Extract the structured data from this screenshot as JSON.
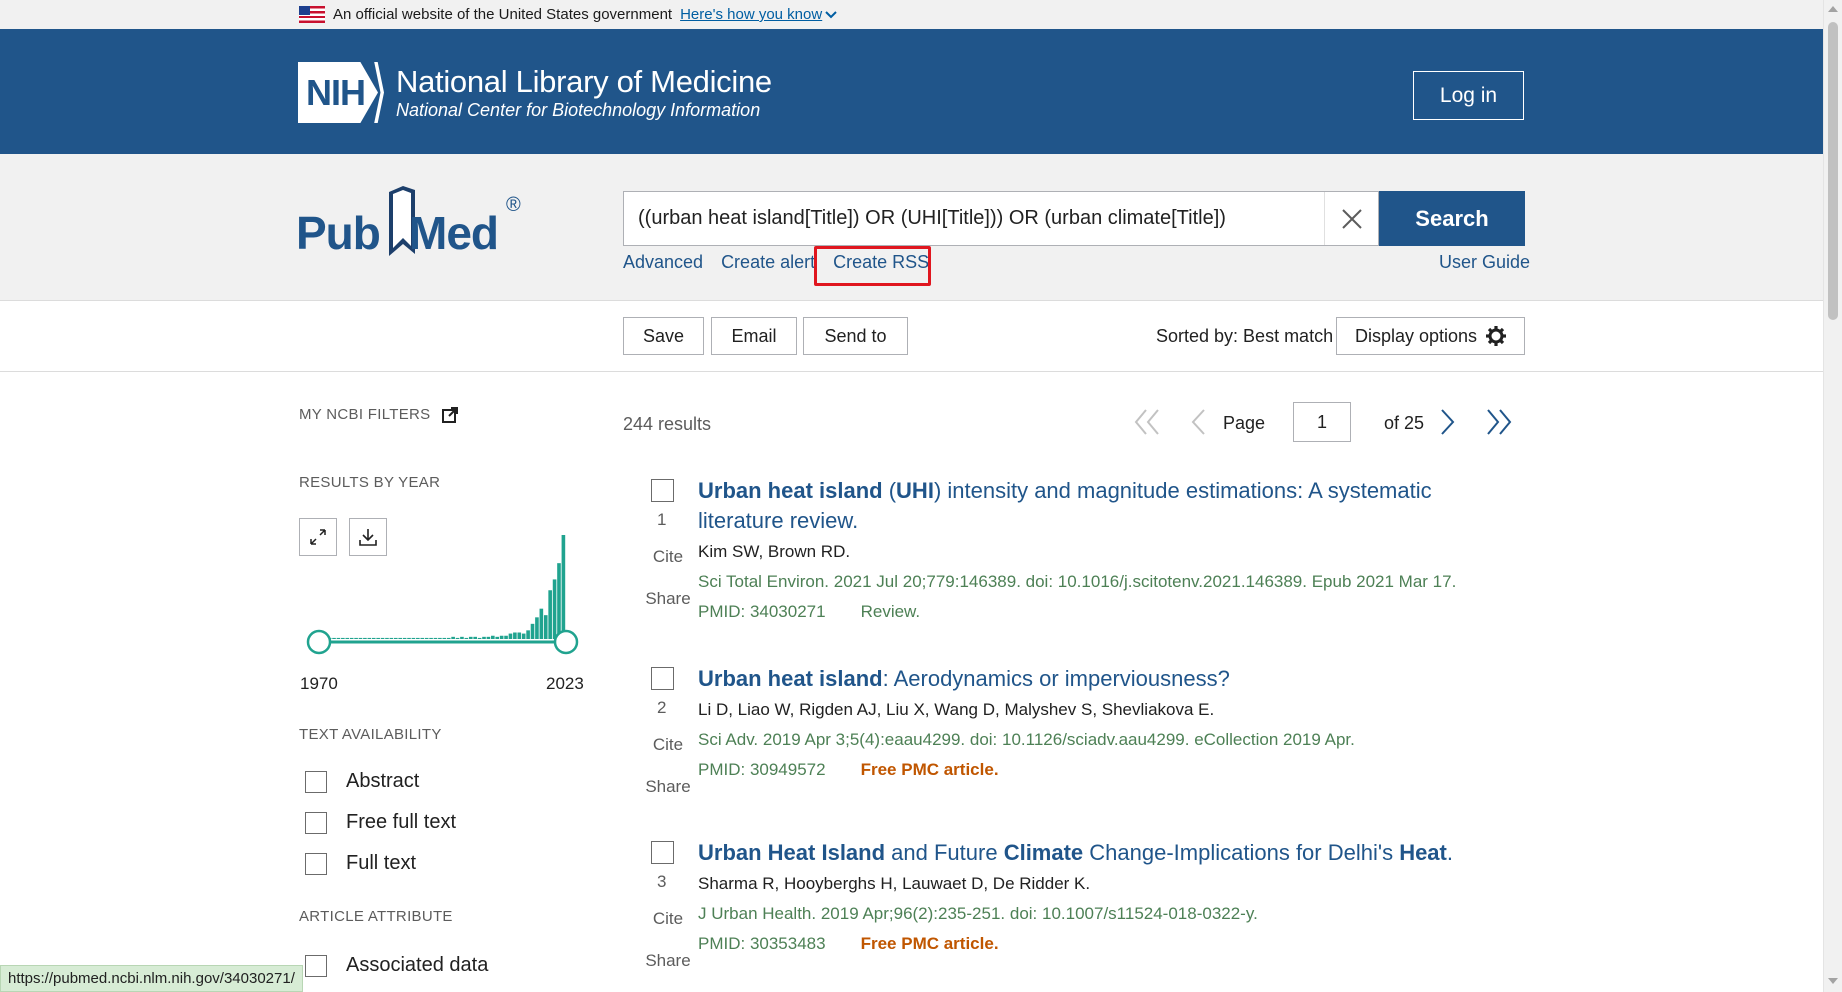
{
  "gov_banner": {
    "text": "An official website of the United States government",
    "link": "Here's how you know"
  },
  "header": {
    "nih_logo": "NIH",
    "title": "National Library of Medicine",
    "subtitle": "National Center for Biotechnology Information",
    "login": "Log in"
  },
  "search": {
    "logo_pub": "Pub",
    "logo_med": "Med",
    "logo_reg": "®",
    "query": "((urban heat island[Title]) OR (UHI[Title])) OR (urban climate[Title])",
    "button": "Search",
    "links": {
      "advanced": "Advanced",
      "create_alert": "Create alert",
      "create_rss": "Create RSS"
    },
    "user_guide": "User Guide"
  },
  "toolbar": {
    "save": "Save",
    "email": "Email",
    "send_to": "Send to",
    "sorted_by": "Sorted by: Best match",
    "display_options": "Display options"
  },
  "sidebar": {
    "my_filters": "MY NCBI FILTERS",
    "results_by_year": "RESULTS BY YEAR",
    "year_start": "1970",
    "year_end": "2023",
    "text_availability": "TEXT AVAILABILITY",
    "filters": [
      "Abstract",
      "Free full text",
      "Full text"
    ],
    "article_attribute": "ARTICLE ATTRIBUTE",
    "attribute_filters": [
      "Associated data"
    ]
  },
  "results_meta": {
    "count": "244 results",
    "page_label": "Page",
    "page_value": "1",
    "page_of": "of 25"
  },
  "results": [
    {
      "number": "1",
      "title_parts": [
        {
          "t": "Urban heat island",
          "b": true
        },
        {
          "t": " (",
          "b": false
        },
        {
          "t": "UHI",
          "b": true
        },
        {
          "t": ") intensity and magnitude estimations: A systematic literature review.",
          "b": false
        }
      ],
      "authors": "Kim SW, Brown RD.",
      "citation": "Sci Total Environ. 2021 Jul 20;779:146389. doi: 10.1016/j.scitotenv.2021.146389. Epub 2021 Mar 17.",
      "pmid": "PMID: 34030271",
      "tag": "Review.",
      "tag_type": "type",
      "cite": "Cite",
      "share": "Share"
    },
    {
      "number": "2",
      "title_parts": [
        {
          "t": "Urban heat island",
          "b": true
        },
        {
          "t": ": Aerodynamics or imperviousness?",
          "b": false
        }
      ],
      "authors": "Li D, Liao W, Rigden AJ, Liu X, Wang D, Malyshev S, Shevliakova E.",
      "citation": "Sci Adv. 2019 Apr 3;5(4):eaau4299. doi: 10.1126/sciadv.aau4299. eCollection 2019 Apr.",
      "pmid": "PMID: 30949572",
      "tag": "Free PMC article.",
      "tag_type": "free",
      "cite": "Cite",
      "share": "Share"
    },
    {
      "number": "3",
      "title_parts": [
        {
          "t": "Urban Heat Island",
          "b": true
        },
        {
          "t": " and Future ",
          "b": false
        },
        {
          "t": "Climate",
          "b": true
        },
        {
          "t": " Change-Implications for Delhi's ",
          "b": false
        },
        {
          "t": "Heat",
          "b": true
        },
        {
          "t": ".",
          "b": false
        }
      ],
      "authors": "Sharma R, Hooyberghs H, Lauwaet D, De Ridder K.",
      "citation": "J Urban Health. 2019 Apr;96(2):235-251. doi: 10.1007/s11524-018-0322-y.",
      "pmid": "PMID: 30353483",
      "tag": "Free PMC article.",
      "tag_type": "free",
      "cite": "Cite",
      "share": "Share"
    }
  ],
  "status_bar": "https://pubmed.ncbi.nlm.nih.gov/34030271/",
  "year_histogram": [
    1,
    1,
    1,
    1,
    1,
    1,
    1,
    1,
    1,
    1,
    1,
    1,
    1,
    1,
    1,
    1,
    1,
    1,
    1,
    1,
    1,
    1,
    1,
    1,
    1,
    1,
    1,
    1,
    1,
    1,
    2,
    1,
    2,
    1,
    2,
    2,
    1,
    2,
    2,
    3,
    2,
    3,
    3,
    5,
    6,
    6,
    5,
    8,
    14,
    20,
    28,
    22,
    45,
    55,
    70,
    96
  ],
  "colors": {
    "brand": "#20558a",
    "histogram": "#20a38f",
    "citation": "#4d8055",
    "free": "#c05600",
    "highlight": "#e0161f"
  }
}
